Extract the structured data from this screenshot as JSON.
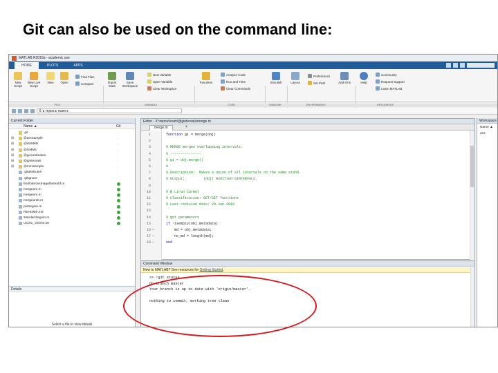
{
  "slide": {
    "title": "Git can also be used on the command line:"
  },
  "app": {
    "window_title": "MATLAB R2018a - academic use"
  },
  "ribbon": {
    "tabs": [
      "HOME",
      "PLOTS",
      "APPS"
    ],
    "file_buttons": [
      "New Script",
      "New Live Script",
      "New",
      "Open"
    ],
    "find_files": "Find Files",
    "compare": "Compare",
    "variable_buttons": [
      "Import Data",
      "Save Workspace"
    ],
    "variable_small": [
      "New Variable",
      "Open Variable",
      "Clear Workspace"
    ],
    "favorites": "Favorites",
    "code_small": [
      "Analyze Code",
      "Run and Time",
      "Clear Commands"
    ],
    "simulink": "Simulink",
    "env_buttons": [
      "Layout"
    ],
    "env_small": [
      "Preferences",
      "Set Path"
    ],
    "addons": "Add-Ons",
    "help": "Help",
    "resources_small": [
      "Community",
      "Request Support",
      "Learn MATLAB"
    ],
    "sections": [
      "FILE",
      "VARIABLE",
      "CODE",
      "SIMULINK",
      "ENVIRONMENT",
      "RESOURCES"
    ]
  },
  "pathbar": {
    "path": "X: ▸ repos ▸ roam ▸"
  },
  "current_folder": {
    "title": "Current Folder",
    "col_name": "Name ▲",
    "col_git": "Git",
    "rows": [
      {
        "name": ".git",
        "type": "folder",
        "expand": ""
      },
      {
        "name": "@amSample",
        "type": "folder",
        "expand": "⊞"
      },
      {
        "name": "@dUMMs",
        "type": "folder",
        "expand": "⊞"
      },
      {
        "name": "@UMMs",
        "type": "folder",
        "expand": "⊞"
      },
      {
        "name": "@gcoordinates",
        "type": "folder",
        "expand": "⊞"
      },
      {
        "name": "@gintervals",
        "type": "folder",
        "expand": "⊞"
      },
      {
        "name": "@mmSample",
        "type": "folder",
        "expand": "⊞"
      },
      {
        "name": ".gitattributes",
        "type": "file",
        "expand": ""
      },
      {
        "name": ".gitignore",
        "type": "file",
        "expand": ""
      },
      {
        "name": "findInterovsmagethresold.m",
        "type": "file",
        "expand": ""
      },
      {
        "name": "mergeum.m",
        "type": "file",
        "expand": ""
      },
      {
        "name": "mergeum.m",
        "type": "file",
        "expand": ""
      },
      {
        "name": "mergeumb.m",
        "type": "file",
        "expand": ""
      },
      {
        "name": "plotregion.m",
        "type": "file",
        "expand": ""
      },
      {
        "name": "README.md",
        "type": "file",
        "expand": ""
      },
      {
        "name": "standardregion.m",
        "type": "file",
        "expand": ""
      },
      {
        "name": "UCSC_Genes.txt",
        "type": "file",
        "expand": ""
      }
    ],
    "details_label": "Details",
    "details_text": "Select a file to view details"
  },
  "editor": {
    "title": "Editor - X:\\repos\\roam\\@gintervals\\merge.m",
    "tab": "merge.m",
    "lines": [
      {
        "n": "1",
        "dash": "",
        "text": "function gi = merge(obj)",
        "kind": "keyword"
      },
      {
        "n": "2",
        "dash": "",
        "text": "",
        "kind": "plain"
      },
      {
        "n": "3",
        "dash": "",
        "text": "% MERGE merges overlapping intervals.",
        "kind": "comment"
      },
      {
        "n": "4",
        "dash": "",
        "text": "% ---------------",
        "kind": "comment"
      },
      {
        "n": "5",
        "dash": "",
        "text": "% gi = obj.merge()",
        "kind": "comment"
      },
      {
        "n": "6",
        "dash": "",
        "text": "%",
        "kind": "comment"
      },
      {
        "n": "7",
        "dash": "",
        "text": "% Description:  Makes a union of all intervals on the same stand.",
        "kind": "comment"
      },
      {
        "n": "8",
        "dash": "",
        "text": "% Output:         (obj) modified GINTERVALS.",
        "kind": "comment"
      },
      {
        "n": "9",
        "dash": "",
        "text": "",
        "kind": "plain"
      },
      {
        "n": "10",
        "dash": "",
        "text": "% @ Liran Carmel",
        "kind": "comment"
      },
      {
        "n": "11",
        "dash": "",
        "text": "% Classification: GET/SET functions",
        "kind": "comment"
      },
      {
        "n": "12",
        "dash": "",
        "text": "% Last revision date: 29-Jan-2019",
        "kind": "comment"
      },
      {
        "n": "13",
        "dash": "",
        "text": "",
        "kind": "plain"
      },
      {
        "n": "14",
        "dash": "",
        "text": "% get parameters",
        "kind": "comment"
      },
      {
        "n": "15",
        "dash": "",
        "text": "if ~isempty(obj.metadata)",
        "kind": "keyword"
      },
      {
        "n": "16",
        "dash": "—",
        "text": "    md = obj.metadata;",
        "kind": "plain"
      },
      {
        "n": "17",
        "dash": "—",
        "text": "    no_md = length(md);",
        "kind": "plain"
      },
      {
        "n": "18",
        "dash": "—",
        "text": "end",
        "kind": "keyword"
      }
    ]
  },
  "command_window": {
    "title": "Command Window",
    "note_prefix": "New to MATLAB? See resources for ",
    "note_link": "Getting Started",
    "note_suffix": ".",
    "lines": [
      ">> !git status",
      "On branch master",
      "Your branch is up to date with 'origin/master'.",
      "",
      "nothing to commit, working tree clean"
    ]
  },
  "workspace": {
    "title": "Workspace",
    "col_name": "Name ▲",
    "rows": [
      "ans"
    ]
  },
  "colors": {
    "ribbon_blue": "#1f5c99",
    "annotation_red": "#d9151b",
    "git_green": "#3aa53a"
  }
}
